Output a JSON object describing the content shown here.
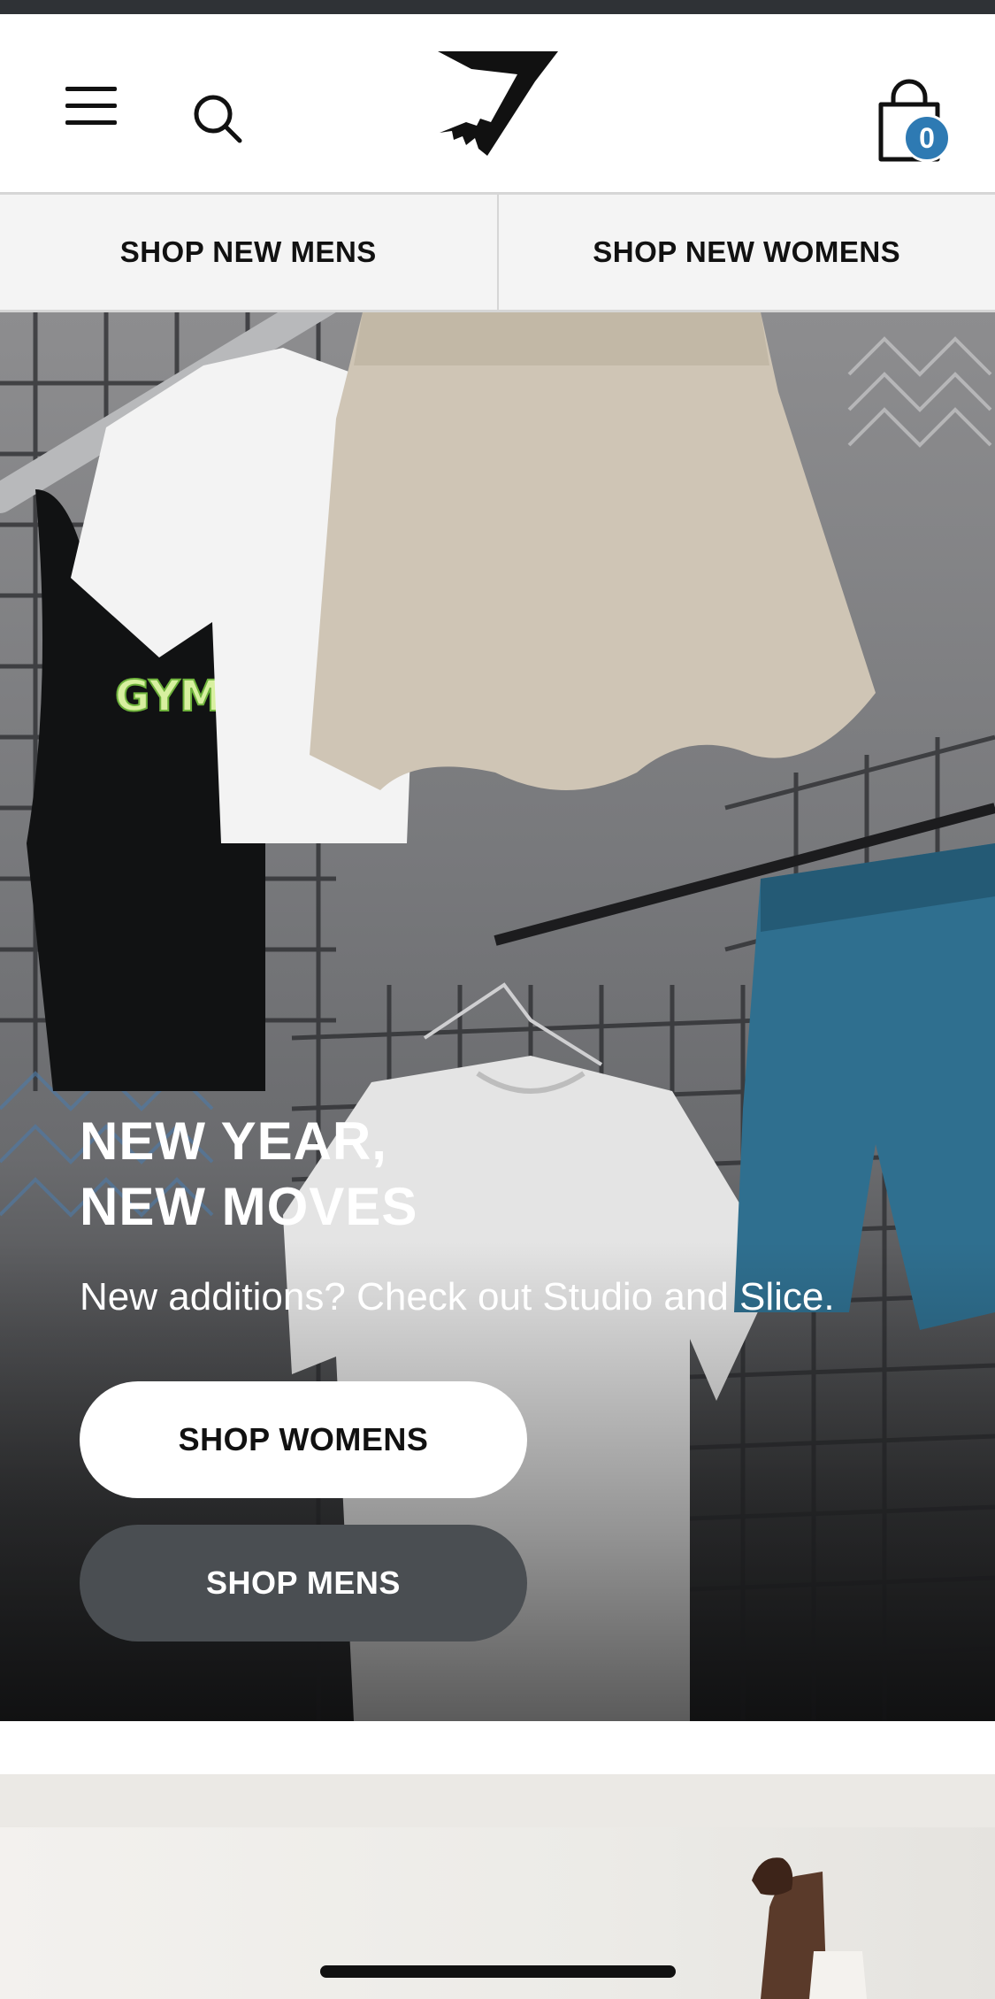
{
  "header": {
    "cart_count": "0"
  },
  "subnav": {
    "items": [
      {
        "label": "SHOP NEW MENS"
      },
      {
        "label": "SHOP NEW WOMENS"
      }
    ]
  },
  "hero": {
    "title_line1": "NEW YEAR,",
    "title_line2": "NEW MOVES",
    "subtitle": "New additions? Check out Studio and Slice.",
    "buttons": {
      "women": "SHOP WOMENS",
      "men": "SHOP MENS"
    }
  },
  "icons": {
    "menu": "hamburger-menu-icon",
    "search": "search-icon",
    "logo": "brand-logo",
    "cart": "shopping-bag-icon"
  },
  "colors": {
    "cart_badge": "#2e7ab3",
    "men_button": "#4a4e52",
    "women_button": "#ffffff"
  }
}
